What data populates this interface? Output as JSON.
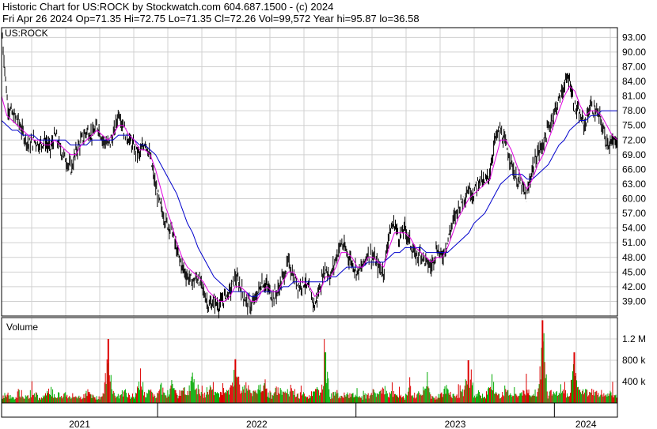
{
  "header": {
    "line1": "Historic Chart for US:ROCK by Stockwatch.com 604.687.1500 - (c) 2024",
    "line2": "Fri Apr 26 2024   Op=71.35   Hi=72.75   Lo=71.35   Cl=72.26   Vol=99,572   Year hi=95.87   lo=36.58"
  },
  "chart_data": [
    {
      "type": "line",
      "title": "US:ROCK",
      "ylim": [
        36.0,
        95.0
      ],
      "y_ticks": [
        "93.00",
        "90.00",
        "87.00",
        "84.00",
        "81.00",
        "78.00",
        "75.00",
        "72.00",
        "69.00",
        "66.00",
        "63.00",
        "60.00",
        "57.00",
        "54.00",
        "51.00",
        "48.00",
        "45.00",
        "42.00",
        "39.00"
      ],
      "x_range": [
        "2021-03-20",
        "2024-04-26"
      ],
      "series": [
        {
          "color": "#000000",
          "values": [
            93,
            79,
            77,
            76,
            73,
            71,
            72,
            71,
            72,
            70,
            73,
            70,
            68,
            66,
            70,
            72,
            74,
            73,
            75,
            72,
            71,
            73,
            78,
            74,
            72,
            70,
            69,
            72,
            68,
            62,
            58,
            55,
            54,
            49,
            46,
            44,
            43,
            44,
            41,
            38,
            39,
            38,
            40,
            41,
            44,
            42,
            39,
            38,
            40,
            43,
            42,
            40,
            41,
            44,
            47,
            44,
            42,
            43,
            41,
            38,
            42,
            46,
            44,
            48,
            51,
            49,
            47,
            45,
            46,
            49,
            48,
            46,
            45,
            53,
            55,
            52,
            54,
            51,
            48,
            49,
            47,
            46,
            50,
            48,
            51,
            55,
            58,
            60,
            62,
            61,
            64,
            63,
            65,
            72,
            74,
            71,
            68,
            64,
            63,
            60,
            66,
            69,
            71,
            74,
            77,
            80,
            83,
            85,
            79,
            77,
            75,
            79,
            78,
            76,
            72,
            71,
            72.26
          ]
        },
        {
          "color": "#e000e0",
          "values": [
            81,
            77,
            76,
            75,
            74,
            73,
            72,
            72,
            71,
            71,
            72,
            71,
            70,
            69,
            69,
            71,
            72,
            73,
            74,
            73,
            72,
            73,
            75,
            75,
            73,
            72,
            70,
            70,
            69,
            66,
            62,
            58,
            55,
            51,
            48,
            46,
            45,
            44,
            43,
            41,
            40,
            39,
            39,
            40,
            42,
            42,
            41,
            39,
            39,
            41,
            42,
            41,
            41,
            43,
            45,
            45,
            43,
            43,
            42,
            40,
            41,
            44,
            44,
            46,
            49,
            49,
            48,
            46,
            46,
            48,
            48,
            47,
            46,
            50,
            53,
            53,
            53,
            52,
            50,
            49,
            48,
            47,
            48,
            48,
            50,
            53,
            56,
            58,
            60,
            61,
            62,
            63,
            64,
            68,
            72,
            72,
            70,
            67,
            64,
            62,
            64,
            67,
            69,
            72,
            75,
            78,
            81,
            83,
            82,
            79,
            77,
            78,
            78,
            77,
            75,
            73,
            72
          ]
        },
        {
          "color": "#0000cc",
          "values": [
            76,
            75,
            74,
            74,
            73,
            73,
            73,
            72,
            72,
            72,
            72,
            72,
            72,
            71,
            71,
            71,
            71,
            72,
            72,
            72,
            72,
            72,
            73,
            73,
            73,
            72,
            71,
            71,
            70,
            69,
            67,
            65,
            63,
            61,
            58,
            55,
            53,
            50,
            48,
            46,
            44,
            43,
            42,
            41,
            41,
            41,
            41,
            40,
            40,
            41,
            41,
            41,
            41,
            42,
            42,
            43,
            43,
            43,
            43,
            43,
            43,
            43,
            44,
            44,
            45,
            46,
            46,
            46,
            46,
            47,
            47,
            47,
            47,
            48,
            49,
            49,
            50,
            50,
            50,
            50,
            49,
            49,
            49,
            49,
            49,
            50,
            51,
            52,
            53,
            55,
            56,
            57,
            59,
            61,
            63,
            64,
            65,
            65,
            65,
            64,
            64,
            65,
            66,
            67,
            69,
            71,
            72,
            74,
            75,
            76,
            76,
            77,
            77,
            78,
            78,
            78,
            78
          ]
        }
      ]
    },
    {
      "type": "bar",
      "title": "Volume",
      "ylim": [
        0,
        1600000
      ],
      "y_ticks": [
        "1.2 M",
        "800 k",
        "400 k"
      ],
      "values": [
        0.18,
        0.25,
        0.12,
        0.3,
        0.15,
        0.2,
        0.35,
        0.1,
        0.22,
        0.4,
        0.18,
        0.15,
        0.28,
        0.12,
        0.2,
        0.16,
        0.3,
        0.24,
        0.14,
        0.2,
        1.2,
        0.25,
        0.18,
        0.35,
        0.22,
        0.15,
        0.6,
        0.2,
        0.3,
        0.14,
        0.45,
        0.25,
        0.5,
        0.2,
        0.4,
        0.3,
        0.7,
        0.35,
        0.2,
        0.45,
        0.25,
        0.3,
        0.5,
        0.4,
        0.82,
        0.3,
        0.45,
        0.25,
        0.35,
        0.6,
        0.3,
        0.2,
        0.4,
        0.25,
        0.3,
        0.35,
        0.2,
        0.3,
        0.15,
        0.4,
        0.25,
        0.95,
        0.2,
        0.3,
        0.15,
        0.25,
        0.2,
        0.35,
        0.15,
        0.2,
        0.3,
        0.2,
        0.45,
        0.25,
        0.3,
        0.2,
        0.15,
        0.4,
        0.2,
        0.3,
        0.55,
        0.2,
        0.15,
        0.3,
        0.4,
        0.2,
        0.25,
        0.3,
        0.8,
        0.2,
        0.3,
        0.15,
        0.45,
        0.3,
        0.2,
        0.35,
        0.25,
        0.2,
        0.3,
        0.4,
        0.25,
        0.3,
        1.55,
        0.2,
        0.35,
        0.25,
        0.3,
        0.2,
        0.95,
        0.4,
        0.3,
        0.35,
        0.25,
        0.3,
        0.2,
        0.3,
        0.25
      ]
    }
  ],
  "x_axis": {
    "labels": [
      "2021",
      "2022",
      "2023",
      "2024"
    ]
  },
  "colors": {
    "price": "#000000",
    "ma_short": "#e000e0",
    "ma_long": "#0000cc",
    "vol_up": "#00aa00",
    "vol_down": "#dd0000",
    "grid": "#d0d0d0"
  }
}
